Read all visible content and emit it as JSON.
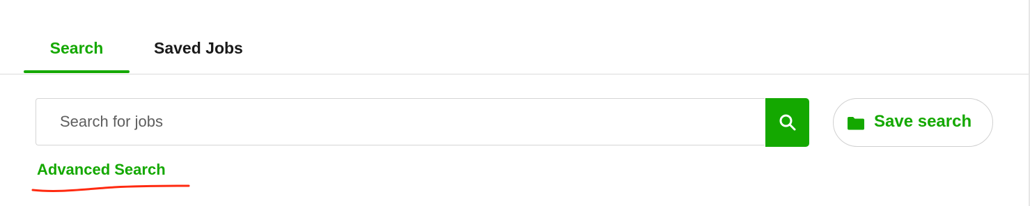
{
  "tabs": [
    {
      "label": "Search",
      "active": true
    },
    {
      "label": "Saved Jobs",
      "active": false
    }
  ],
  "search": {
    "placeholder": "Search for jobs",
    "value": "",
    "button_icon": "search-icon"
  },
  "save_search": {
    "label": "Save search",
    "icon": "folder-icon"
  },
  "advanced_search": {
    "label": "Advanced Search"
  },
  "colors": {
    "accent": "#14a800",
    "text": "#1a1a1a",
    "border": "#d5d5d5",
    "annotation": "#ff2a10"
  }
}
